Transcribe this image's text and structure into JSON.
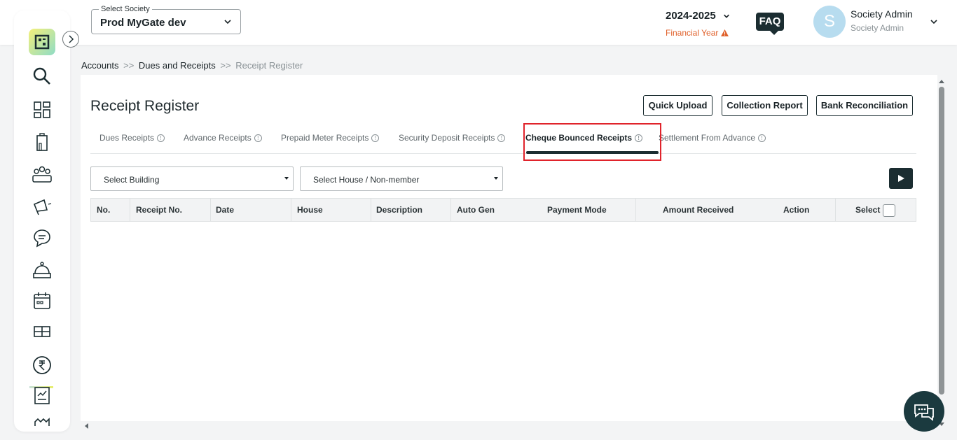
{
  "header": {
    "society_label": "Select Society",
    "society_value": "Prod MyGate dev",
    "financial_year": "2024-2025",
    "financial_year_label": "Financial Year",
    "faq": "FAQ",
    "avatar_initial": "S",
    "user_name": "Society Admin",
    "user_role": "Society Admin"
  },
  "sidebar": {
    "items": [
      "search-icon",
      "dashboard-icon",
      "building-icon",
      "community-icon",
      "announcement-icon",
      "chat-icon",
      "helpdesk-icon",
      "calendar-icon",
      "amenities-icon",
      "accounts-icon",
      "reports-icon",
      "settings-icon"
    ],
    "active": "accounts-icon"
  },
  "breadcrumb": {
    "level1": "Accounts",
    "sep1": ">>",
    "level2": "Dues and Receipts",
    "sep2": ">>",
    "current": "Receipt Register"
  },
  "page": {
    "title": "Receipt Register",
    "buttons": {
      "quick_upload": "Quick Upload",
      "collection_report": "Collection Report",
      "bank_reconciliation": "Bank Reconciliation"
    },
    "tabs": [
      {
        "label": "Dues Receipts"
      },
      {
        "label": "Advance Receipts"
      },
      {
        "label": "Prepaid Meter Receipts"
      },
      {
        "label": "Security Deposit Receipts"
      },
      {
        "label": "Cheque Bounced Receipts"
      },
      {
        "label": "Settlement From Advance"
      }
    ],
    "active_tab": "Cheque Bounced Receipts",
    "filters": {
      "building": "Select Building",
      "house": "Select House / Non-member"
    },
    "table": {
      "columns": [
        "No.",
        "Receipt No.",
        "Date",
        "House",
        "Description",
        "Auto Gen",
        "Payment Mode",
        "Amount Received",
        "Action",
        "Select"
      ],
      "rows": []
    }
  },
  "colors": {
    "primary": "#1b2d31",
    "warning": "#e0612b",
    "highlight": "#e0232b"
  }
}
